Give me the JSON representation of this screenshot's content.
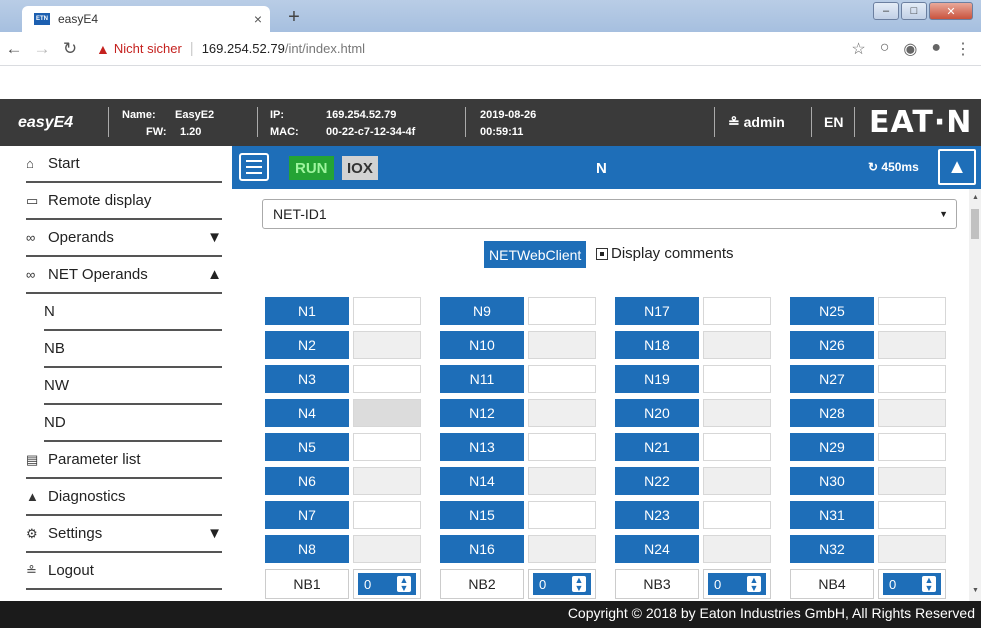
{
  "browser": {
    "tab_title": "easyE4",
    "tab_favicon_text": "ETN",
    "security_label": "Nicht sicher",
    "url_host": "169.254.52.79",
    "url_path": "/int/index.html"
  },
  "header": {
    "app_name": "easyE4",
    "name_label": "Name:",
    "name_value": "EasyE2",
    "fw_label": "FW:",
    "fw_value": "1.20",
    "ip_label": "IP:",
    "ip_value": "169.254.52.79",
    "mac_label": "MAC:",
    "mac_value": "00-22-c7-12-34-4f",
    "date": "2019-08-26",
    "time": "00:59:11",
    "user": "admin",
    "language": "EN",
    "logo_text": "EAT·N"
  },
  "sidebar": {
    "items": [
      {
        "label": "Start",
        "icon": "home-icon"
      },
      {
        "label": "Remote display",
        "icon": "monitor-icon"
      },
      {
        "label": "Operands",
        "icon": "link-icon",
        "arrow": "▼"
      },
      {
        "label": "NET Operands",
        "icon": "link-icon",
        "arrow": "▲"
      },
      {
        "label": "Parameter list",
        "icon": "list-icon"
      },
      {
        "label": "Diagnostics",
        "icon": "warning-icon"
      },
      {
        "label": "Settings",
        "icon": "gear-icon",
        "arrow": "▼"
      },
      {
        "label": "Logout",
        "icon": "user-icon"
      }
    ],
    "subitems": [
      "N",
      "NB",
      "NW",
      "ND"
    ]
  },
  "toolbar": {
    "run_label": "RUN",
    "iox_label": "IOX",
    "title": "N",
    "refresh_rate": "450ms"
  },
  "main": {
    "net_select_value": "NET-ID1",
    "netwebclient_label": "NETWebClient",
    "display_comments_label": "Display comments",
    "display_comments_checked": true,
    "columns": [
      [
        "N1",
        "N2",
        "N3",
        "N4",
        "N5",
        "N6",
        "N7",
        "N8"
      ],
      [
        "N9",
        "N10",
        "N11",
        "N12",
        "N13",
        "N14",
        "N15",
        "N16"
      ],
      [
        "N17",
        "N18",
        "N19",
        "N20",
        "N21",
        "N22",
        "N23",
        "N24"
      ],
      [
        "N25",
        "N26",
        "N27",
        "N28",
        "N29",
        "N30",
        "N31",
        "N32"
      ]
    ],
    "nb_row": [
      {
        "label": "NB1",
        "value": "0"
      },
      {
        "label": "NB2",
        "value": "0"
      },
      {
        "label": "NB3",
        "value": "0"
      },
      {
        "label": "NB4",
        "value": "0"
      }
    ]
  },
  "footer": {
    "copyright": "Copyright © 2018 by Eaton Industries GmbH, All Rights Reserved"
  },
  "colors": {
    "accent_blue": "#1e6eb8",
    "run_green": "#24a334",
    "header_dark": "#3a3a3a"
  }
}
